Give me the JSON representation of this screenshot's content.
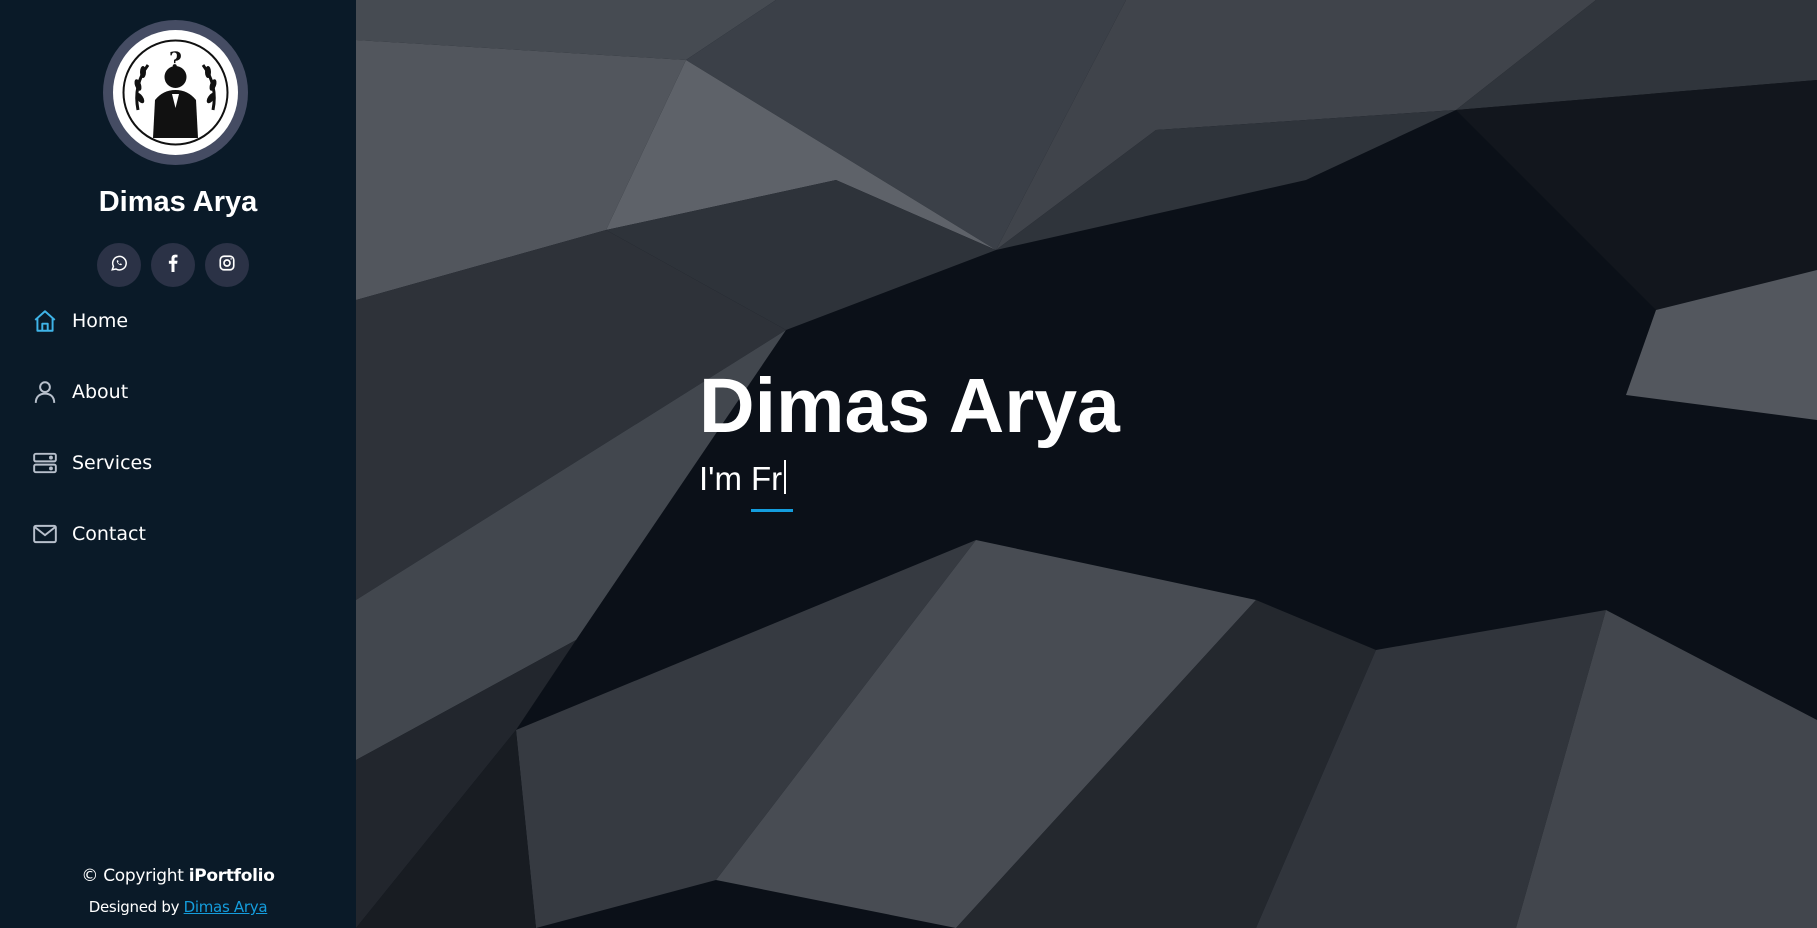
{
  "profile": {
    "name": "Dimas Arya",
    "avatar_icon": "anonymous-mask-logo"
  },
  "socials": [
    {
      "icon": "whatsapp-icon"
    },
    {
      "icon": "facebook-icon"
    },
    {
      "icon": "instagram-icon"
    }
  ],
  "nav": {
    "items": [
      {
        "label": "Home",
        "icon": "home-icon",
        "active": true
      },
      {
        "label": "About",
        "icon": "person-icon"
      },
      {
        "label": "Services",
        "icon": "server-icon"
      },
      {
        "label": "Contact",
        "icon": "envelope-icon"
      }
    ]
  },
  "footer": {
    "copyright_prefix": "© Copyright ",
    "brand": "iPortfolio",
    "designed_by": "Designed by ",
    "designer": "Dimas Arya"
  },
  "hero": {
    "title": "Dimas Arya",
    "prefix": "I'm",
    "typed": "Fr"
  },
  "colors": {
    "sidebar_bg": "#0a1a28",
    "accent": "#149ddd",
    "social_bg": "#2b3246",
    "active_icon": "#3fb4e8"
  }
}
